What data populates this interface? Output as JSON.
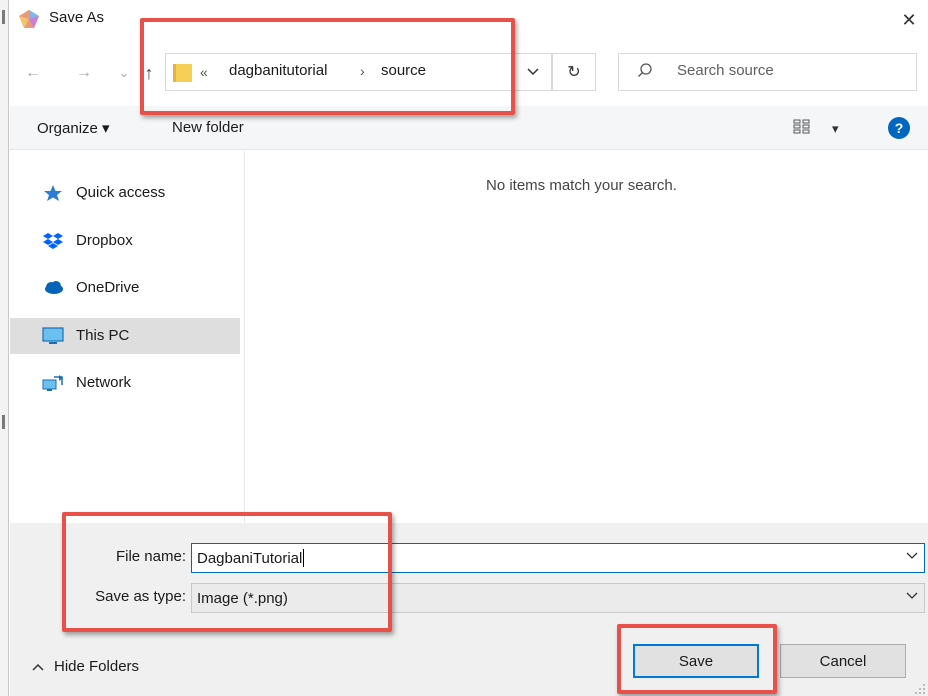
{
  "window": {
    "title": "Save As",
    "close_glyph": "✕"
  },
  "nav": {
    "back_glyph": "←",
    "forward_glyph": "→",
    "recent_glyph": "⌄",
    "up_glyph": "↑",
    "overflow_glyph": "«",
    "breadcrumbs": [
      "dagbanitutorial",
      "source"
    ],
    "separator_glyph": "›",
    "refresh_glyph": "↻"
  },
  "search": {
    "placeholder": "Search source"
  },
  "toolbar": {
    "organize_label": "Organize ▾",
    "new_folder_label": "New folder",
    "view_dropdown_glyph": "▾",
    "help_glyph": "?"
  },
  "sidebar": {
    "items": [
      {
        "label": "Quick access",
        "icon": "star-icon"
      },
      {
        "label": "Dropbox",
        "icon": "dropbox-icon"
      },
      {
        "label": "OneDrive",
        "icon": "cloud-icon"
      },
      {
        "label": "This PC",
        "icon": "monitor-icon",
        "selected": true
      },
      {
        "label": "Network",
        "icon": "network-icon"
      }
    ]
  },
  "content": {
    "empty_message": "No items match your search."
  },
  "form": {
    "file_name_label": "File name:",
    "file_name_value": "DagbaniTutorial",
    "save_type_label": "Save as type:",
    "save_type_value": "Image (*.png)"
  },
  "footer": {
    "hide_folders_label": "Hide Folders",
    "hide_folders_glyph": "^",
    "save_label": "Save",
    "cancel_label": "Cancel"
  },
  "colors": {
    "highlight": "#e8514a",
    "accent": "#0078d7",
    "folder": "#f6cf57"
  }
}
